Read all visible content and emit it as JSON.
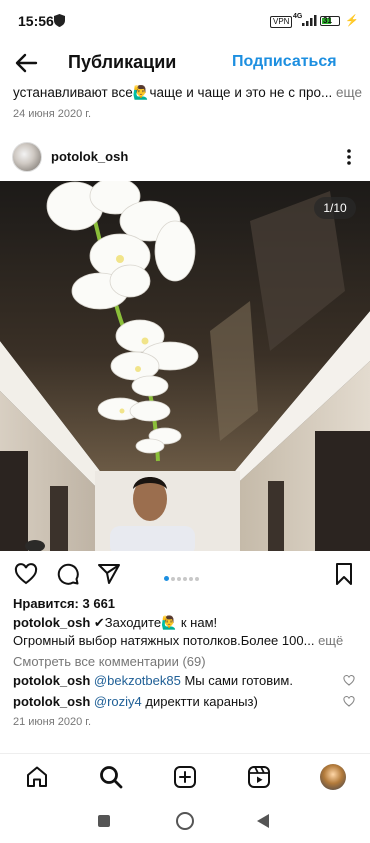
{
  "status_bar": {
    "time": "15:56",
    "vpn": "VPN",
    "network": "4G",
    "battery": "31"
  },
  "header": {
    "title": "Публикации",
    "subscribe": "Подписаться"
  },
  "previous_post": {
    "caption": "устанавливают все🙋‍♂️чаще и чаще и это не с про...",
    "more": "еще",
    "date": "24 июня 2020 г."
  },
  "post": {
    "username": "potolok_osh",
    "counter": "1/10",
    "likes": "Нравится: 3 661",
    "caption_user": "potolok_osh",
    "caption_line1": "✔Заходите🙋‍♂️ к нам!",
    "caption_line2": "Огромный выбор натяжных потолков.Более 100...",
    "caption_more": "ещё",
    "view_all_comments": "Смотреть все комментарии (69)",
    "comments": [
      {
        "user": "potolok_osh",
        "mention": "@bekzotbek85",
        "text": "Мы сами готовим."
      },
      {
        "user": "potolok_osh",
        "mention": "@roziy4",
        "text": "директти караныз)"
      }
    ],
    "date": "21 июня 2020 г.",
    "carousel_total": 6,
    "carousel_active": 0
  },
  "bottom_nav": [
    "home-icon",
    "search-icon",
    "new-post-icon",
    "reels-icon",
    "profile-avatar"
  ],
  "colors": {
    "accent": "#1d8fe0",
    "mention": "#1f5f96",
    "muted": "#777777"
  }
}
